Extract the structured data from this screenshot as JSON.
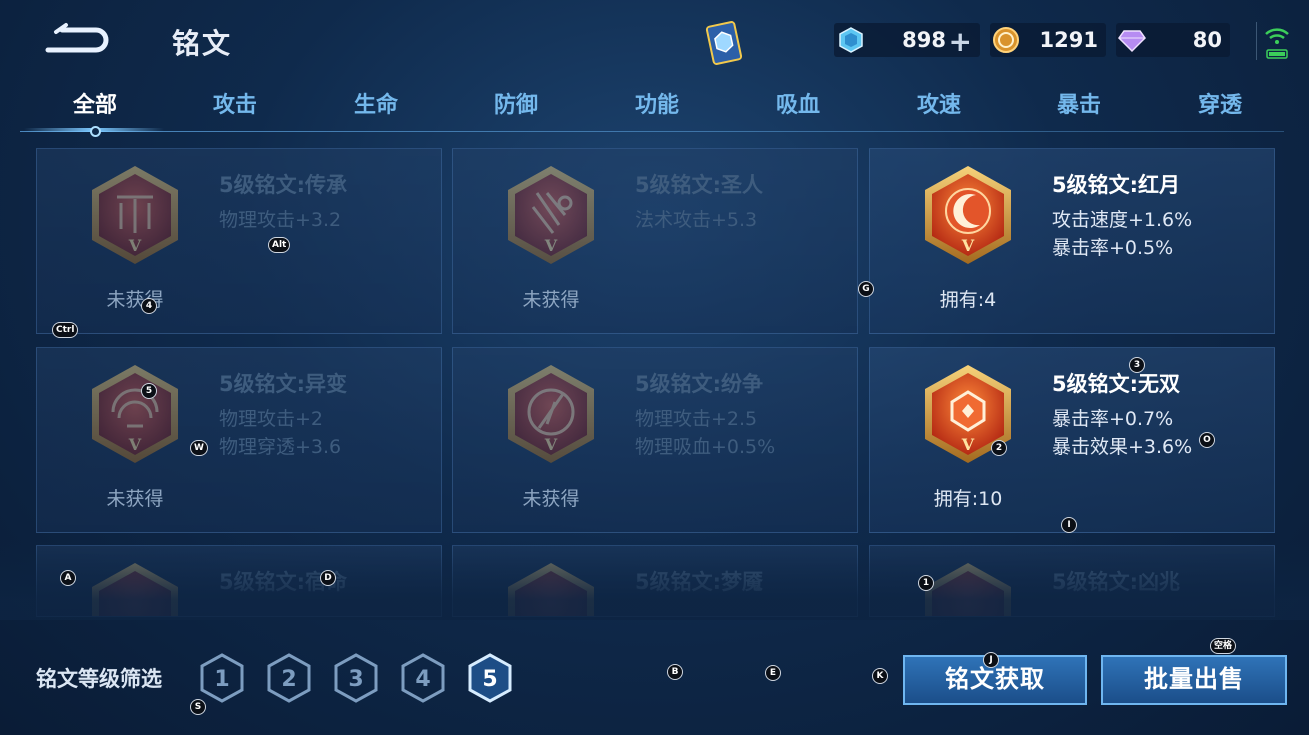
{
  "header": {
    "title": "铭文",
    "currencies": [
      {
        "icon": "blue-crystal-icon",
        "value": "898",
        "has_plus": true
      },
      {
        "icon": "gold-coin-icon",
        "value": "1291",
        "has_plus": false
      },
      {
        "icon": "purple-gem-icon",
        "value": "80",
        "has_plus": false
      }
    ],
    "plus_label": "+"
  },
  "tabs": [
    {
      "label": "全部",
      "active": true
    },
    {
      "label": "攻击"
    },
    {
      "label": "生命"
    },
    {
      "label": "防御"
    },
    {
      "label": "功能"
    },
    {
      "label": "吸血"
    },
    {
      "label": "攻速"
    },
    {
      "label": "暴击"
    },
    {
      "label": "穿透"
    }
  ],
  "inscriptions": [
    {
      "name": "5级铭文:传承",
      "stats": [
        "物理攻击+3.2"
      ],
      "status": "未获得",
      "owned": false,
      "color": "#c0392b"
    },
    {
      "name": "5级铭文:圣人",
      "stats": [
        "法术攻击+5.3"
      ],
      "status": "未获得",
      "owned": false,
      "color": "#c0392b"
    },
    {
      "name": "5级铭文:红月",
      "stats": [
        "攻击速度+1.6%",
        "暴击率+0.5%"
      ],
      "status": "拥有:4",
      "owned": true,
      "color": "#e0501f"
    },
    {
      "name": "5级铭文:异变",
      "stats": [
        "物理攻击+2",
        "物理穿透+3.6"
      ],
      "status": "未获得",
      "owned": false,
      "color": "#c0392b"
    },
    {
      "name": "5级铭文:纷争",
      "stats": [
        "物理攻击+2.5",
        "物理吸血+0.5%"
      ],
      "status": "未获得",
      "owned": false,
      "color": "#c0392b"
    },
    {
      "name": "5级铭文:无双",
      "stats": [
        "暴击率+0.7%",
        "暴击效果+3.6%"
      ],
      "status": "拥有:10",
      "owned": true,
      "color": "#e0501f"
    },
    {
      "name": "5级铭文:宿命",
      "stats": [],
      "status": "",
      "owned": false,
      "color": "#c0392b"
    },
    {
      "name": "5级铭文:梦魇",
      "stats": [],
      "status": "",
      "owned": false,
      "color": "#c0392b"
    },
    {
      "name": "5级铭文:凶兆",
      "stats": [],
      "status": "",
      "owned": false,
      "color": "#c0392b"
    }
  ],
  "emblem_letter": "V",
  "filter": {
    "label": "铭文等级筛选",
    "levels": [
      "1",
      "2",
      "3",
      "4",
      "5"
    ],
    "selected": "5"
  },
  "buttons": {
    "acquire": "铭文获取",
    "sell": "批量出售"
  },
  "key_hints": [
    "Alt",
    "Ctrl",
    "4",
    "5",
    "W",
    "G",
    "3",
    "2",
    "O",
    "I",
    "A",
    "D",
    "1",
    "J",
    "空格",
    "B",
    "E",
    "K",
    "S"
  ],
  "colors": {
    "accent": "#74b8ec",
    "button": "#2f73b8",
    "owned_emblem": "#e0501f"
  }
}
